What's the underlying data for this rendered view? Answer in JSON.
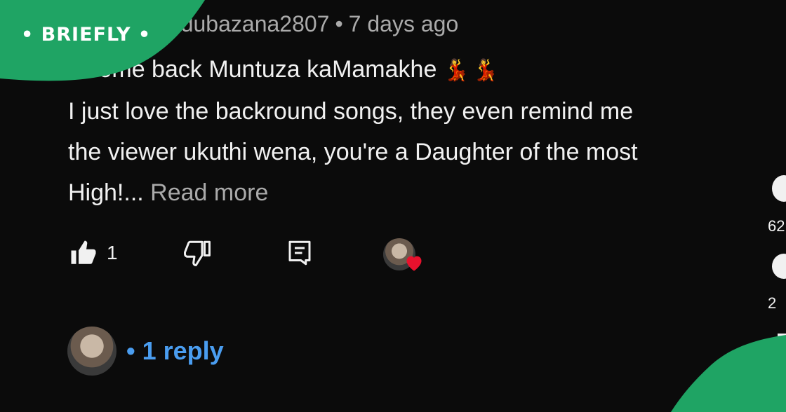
{
  "brand": {
    "name": "BRIEFLY",
    "color": "#1fa464"
  },
  "comment": {
    "username": "uladubazana2807",
    "separator": "•",
    "timestamp": "7 days ago",
    "lines": [
      "elcome back Muntuza kaMamakhe",
      "I just love the backround songs, they even remind me",
      "the viewer ukuthi wena, you're a Daughter of the most",
      "High!..."
    ],
    "emoji": "💃💃",
    "read_more": "Read more"
  },
  "actions": {
    "like_count": "1",
    "like_icon": "thumbs-up-icon",
    "dislike_icon": "thumbs-down-icon",
    "reply_icon": "comment-reply-icon",
    "creator_heart_icon": "heart-icon"
  },
  "replies": {
    "separator": "•",
    "label": "1 reply"
  },
  "side_actions": {
    "like_count": "62",
    "comment_count": "2"
  },
  "colors": {
    "background": "#0b0b0b",
    "link": "#4a9df0",
    "heart": "#e8112d",
    "muted": "#aaaaaa"
  }
}
